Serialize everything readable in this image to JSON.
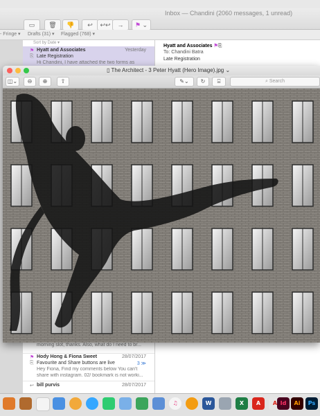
{
  "mail": {
    "window_title": "Inbox — Chandini (2060 messages, 1 unread)",
    "favorites": {
      "fringe": "- Fringe ▾",
      "drafts": "Drafts (31) ▾",
      "flagged": "Flagged (768) ▾"
    },
    "sort_label": "Sort by Date ▾",
    "messages": [
      {
        "from": "Hyatt and Associates",
        "date": "Yesterday",
        "subject": "Late Registration",
        "preview": "Hi Chandini, I have attached the two forms as"
      },
      {
        "from": "",
        "date": "",
        "subject": "",
        "preview": "morning slot, thanks. Also, what do I need to br..."
      },
      {
        "from": "Hody Hong & Fiona Sweet",
        "date": "28/07/2017",
        "subject": "Favourite and Share buttons are live",
        "count": "3 ≫",
        "preview": "Hey Fiona, Find my comments below You can't",
        "preview2": "share with instagram. 02/ bookmark is not worki..."
      },
      {
        "from": "bill purvis",
        "date": "28/07/2017",
        "subject": "",
        "preview": ""
      }
    ],
    "detail": {
      "from": "Hyatt and Associates",
      "to": "To:  Chandini Batra",
      "subject": "Late Registration"
    }
  },
  "preview_window": {
    "title": "The Architect - 3 Peter Hyatt (Hero Image).jpg ⌄",
    "search_placeholder": "Search"
  },
  "colors": {
    "flag": "#c24bd6",
    "selection": "#d8d3ec"
  }
}
